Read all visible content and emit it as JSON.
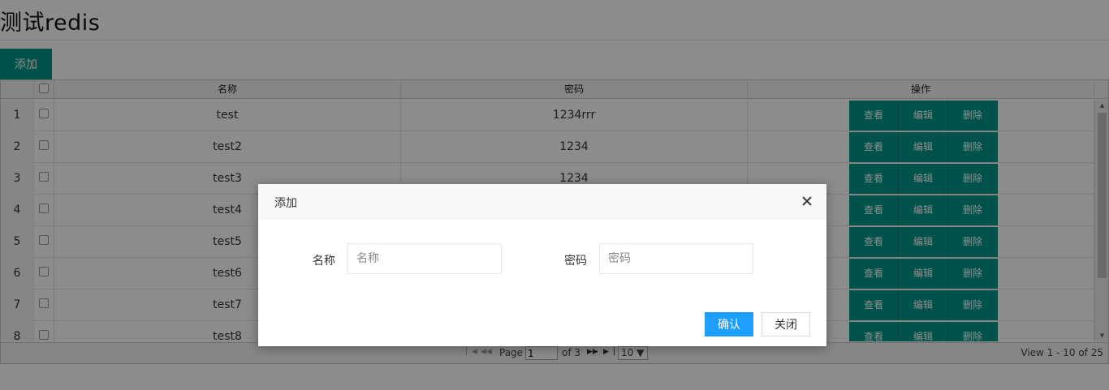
{
  "page": {
    "title": "测试redis",
    "add_label": "添加"
  },
  "table": {
    "headers": [
      "名称",
      "密码",
      "操作"
    ],
    "rows": [
      {
        "index": "1",
        "name": "test",
        "password": "1234rrr"
      },
      {
        "index": "2",
        "name": "test2",
        "password": "1234"
      },
      {
        "index": "3",
        "name": "test3",
        "password": "1234"
      },
      {
        "index": "4",
        "name": "test4",
        "password": ""
      },
      {
        "index": "5",
        "name": "test5",
        "password": ""
      },
      {
        "index": "6",
        "name": "test6",
        "password": ""
      },
      {
        "index": "7",
        "name": "test7",
        "password": ""
      },
      {
        "index": "8",
        "name": "test8",
        "password": ""
      }
    ],
    "actions": [
      "查看",
      "编辑",
      "删除"
    ]
  },
  "pager": {
    "page_label": "Page",
    "current_page": "1",
    "of_label": "of 3",
    "page_size": "10 ▼",
    "view_info": "View 1 - 10 of 25"
  },
  "modal": {
    "title": "添加",
    "name_label": "名称",
    "name_placeholder": "名称",
    "password_label": "密码",
    "password_placeholder": "密码",
    "confirm_label": "确认",
    "close_label": "关闭"
  },
  "colors": {
    "primary": "#009688",
    "confirm": "#1e9fff"
  }
}
